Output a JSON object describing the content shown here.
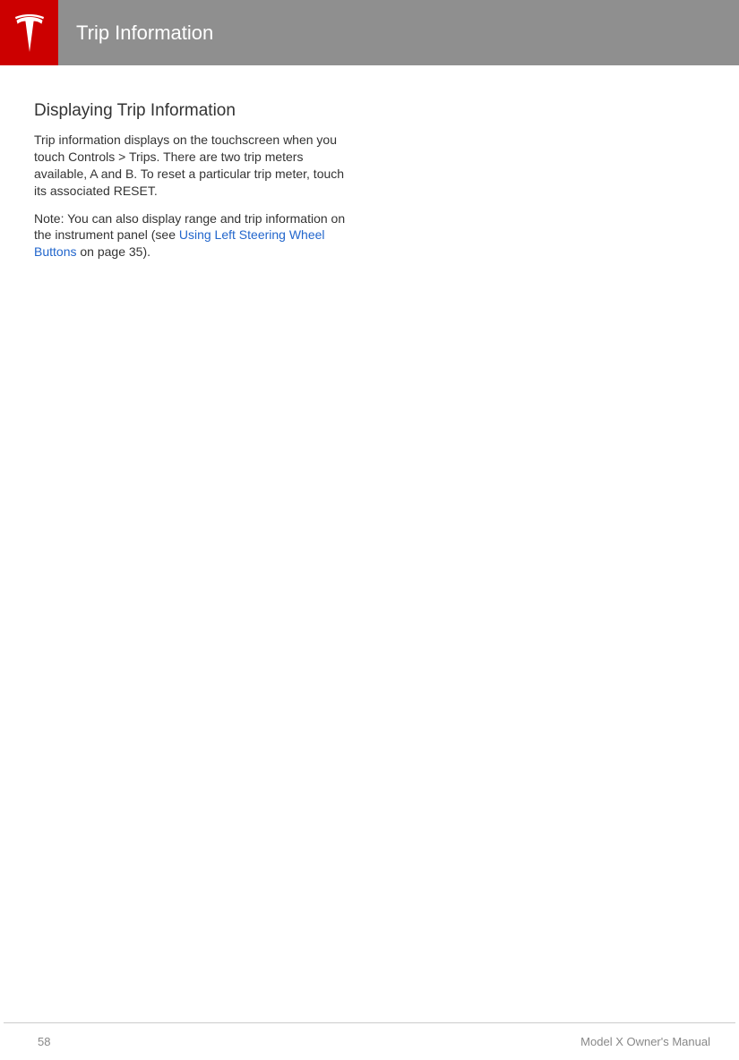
{
  "header": {
    "title": "Trip Information"
  },
  "content": {
    "section_heading": "Displaying Trip Information",
    "body_paragraph": "Trip information displays on the touchscreen when you touch Controls > Trips. There are two trip meters available, A and B. To reset a particular trip meter, touch its associated RESET.",
    "note_prefix": "Note: You can also display range and trip information on the instrument panel (see ",
    "note_link_text": "Using Left Steering Wheel Buttons",
    "note_suffix": " on page 35)."
  },
  "footer": {
    "page_number": "58",
    "manual_title": "Model X Owner's Manual"
  }
}
